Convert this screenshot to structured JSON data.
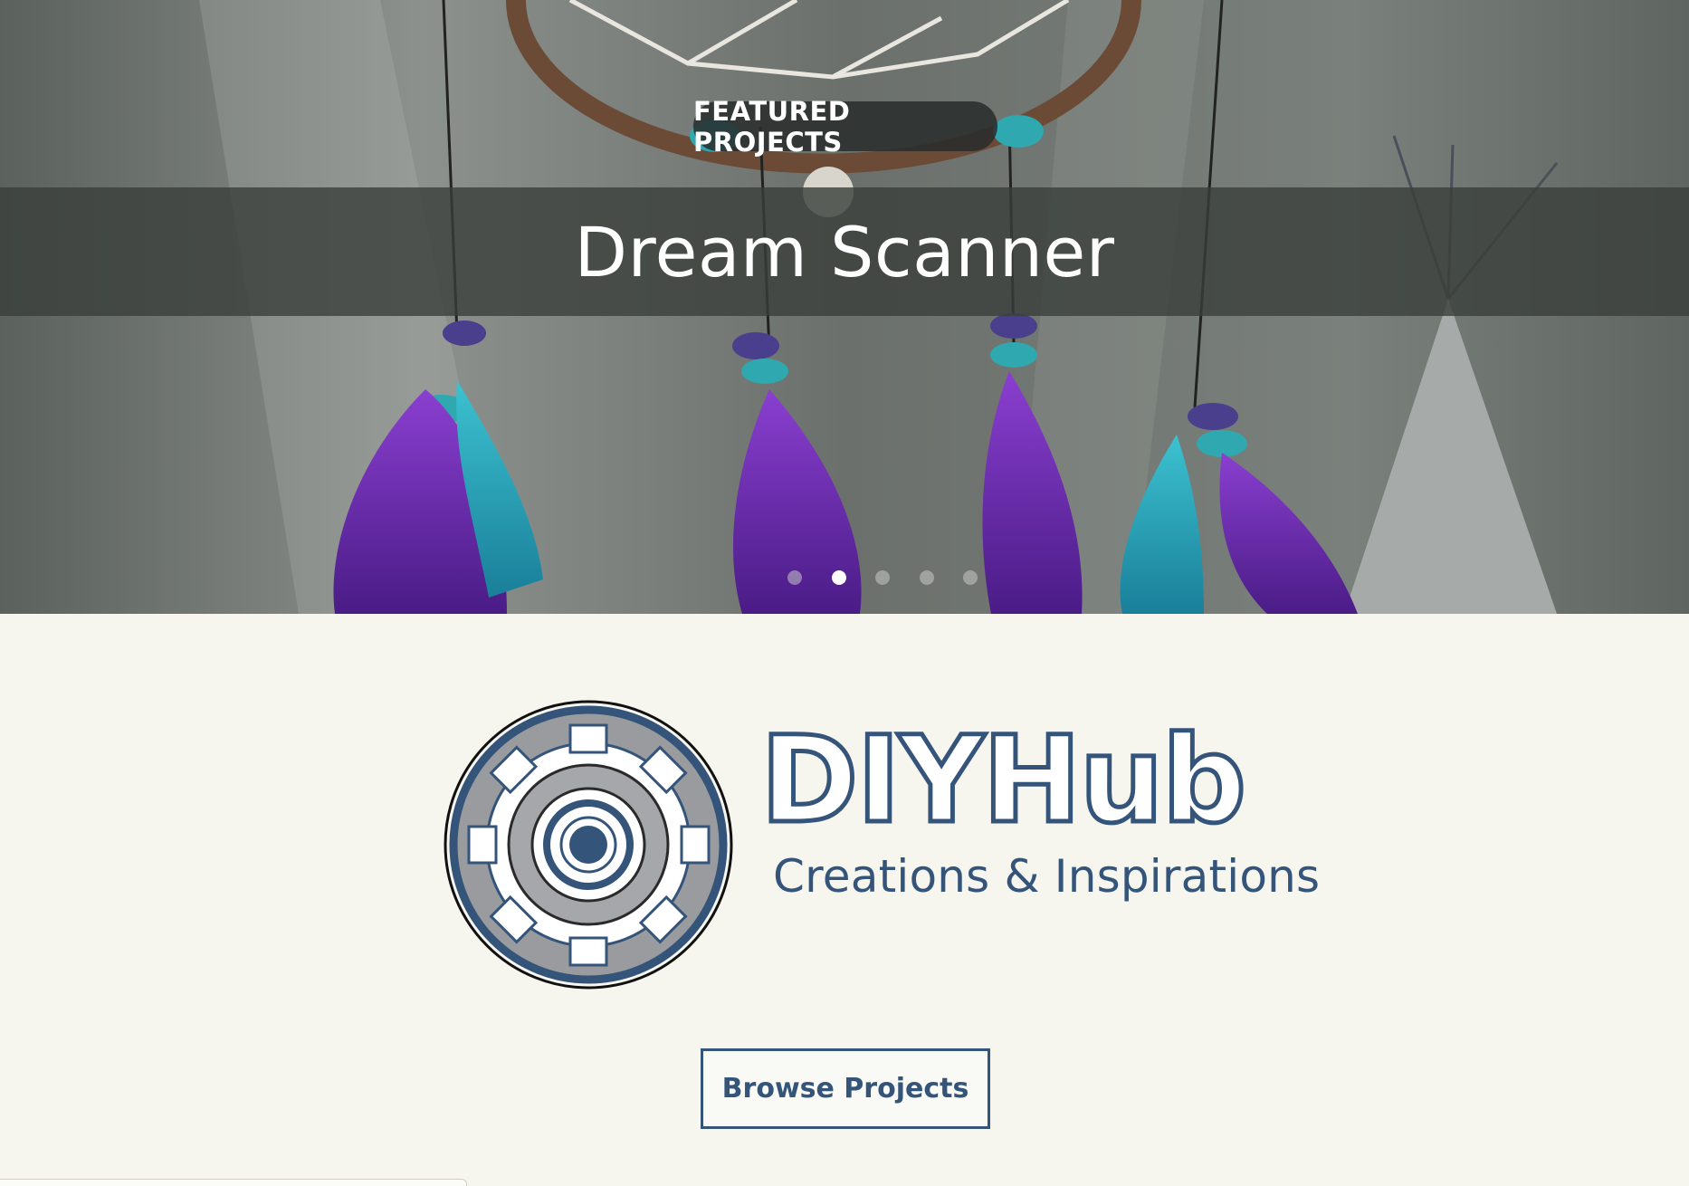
{
  "hero": {
    "badge": "FEATURED PROJECTS",
    "title": "Dream Scanner",
    "slides": [
      "slide-1",
      "slide-2",
      "slide-3",
      "slide-4",
      "slide-5"
    ],
    "active_slide": 2
  },
  "brand": {
    "name": "DIYHub",
    "tagline": "Creations & Inspirations"
  },
  "actions": {
    "browse_label": "Browse Projects"
  },
  "colors": {
    "brand_blue": "#34547a",
    "background": "#f6f5ee",
    "feather_purple": "#6a2fb0",
    "bead_teal": "#2fa8b0"
  }
}
